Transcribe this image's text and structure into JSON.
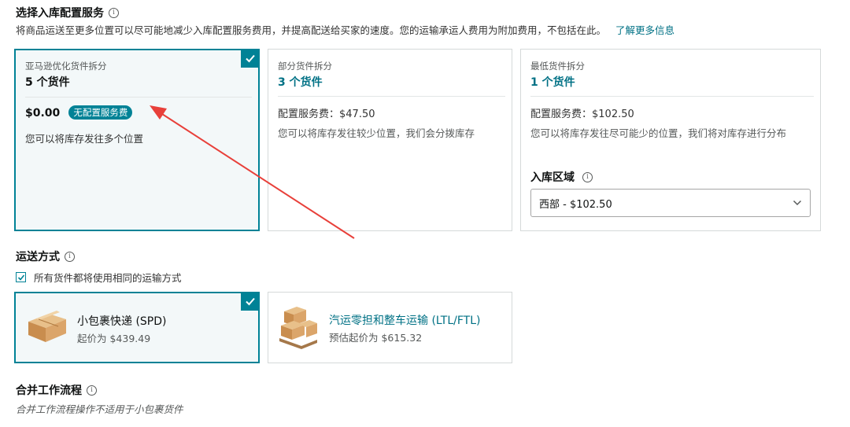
{
  "placement": {
    "title": "选择入库配置服务",
    "description": "将商品运送至更多位置可以尽可能地减少入库配置服务费用，并提高配送给买家的速度。您的运输承运人费用为附加费用，不包括在此。",
    "learn_more": "了解更多信息",
    "options": [
      {
        "label": "亚马逊优化货件拆分",
        "count": "5 个货件",
        "price": "$0.00",
        "badge": "无配置服务费",
        "note": "您可以将库存发往多个位置",
        "selected": true
      },
      {
        "label": "部分货件拆分",
        "count": "3 个货件",
        "fee": "配置服务费：$47.50",
        "note": "您可以将库存发往较少位置，我们会分拨库存",
        "selected": false
      },
      {
        "label": "最低货件拆分",
        "count": "1 个货件",
        "fee": "配置服务费：$102.50",
        "note": "您可以将库存发往尽可能少的位置，我们将对库存进行分布",
        "region_label": "入库区域",
        "region_value": "西部 - $102.50",
        "selected": false
      }
    ]
  },
  "shipping": {
    "title": "运送方式",
    "same_method_label": "所有货件都将使用相同的运输方式",
    "same_method_checked": true,
    "options": [
      {
        "name": "小包裹快递 (SPD)",
        "sub": "起价为 $439.49",
        "icon": "small-parcel-box-icon",
        "selected": true
      },
      {
        "name": "汽运零担和整车运输 (LTL/FTL)",
        "sub": "预估起价为 $615.32",
        "icon": "pallet-boxes-icon",
        "selected": false
      }
    ]
  },
  "workflow": {
    "title": "合并工作流程",
    "note": "合并工作流程操作不适用于小包裹货件"
  },
  "colors": {
    "accent": "#008296",
    "link": "#007185",
    "arrow": "#e8403a"
  }
}
